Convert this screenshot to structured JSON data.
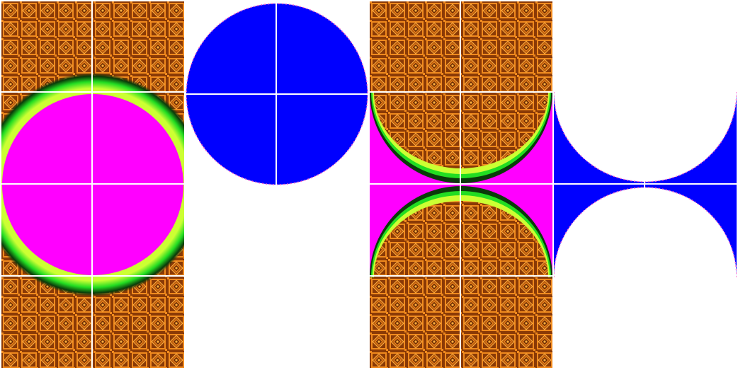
{
  "colors": {
    "tile_dark": "#8a3a06",
    "tile_mid": "#b85a0e",
    "tile_light": "#f08a1e",
    "tile_accent": "#ffb040",
    "magenta": "#ff00ff",
    "blue": "#0000ff",
    "green": "#00e000",
    "lime": "#ccff33",
    "grid_line": "#ffffff"
  }
}
